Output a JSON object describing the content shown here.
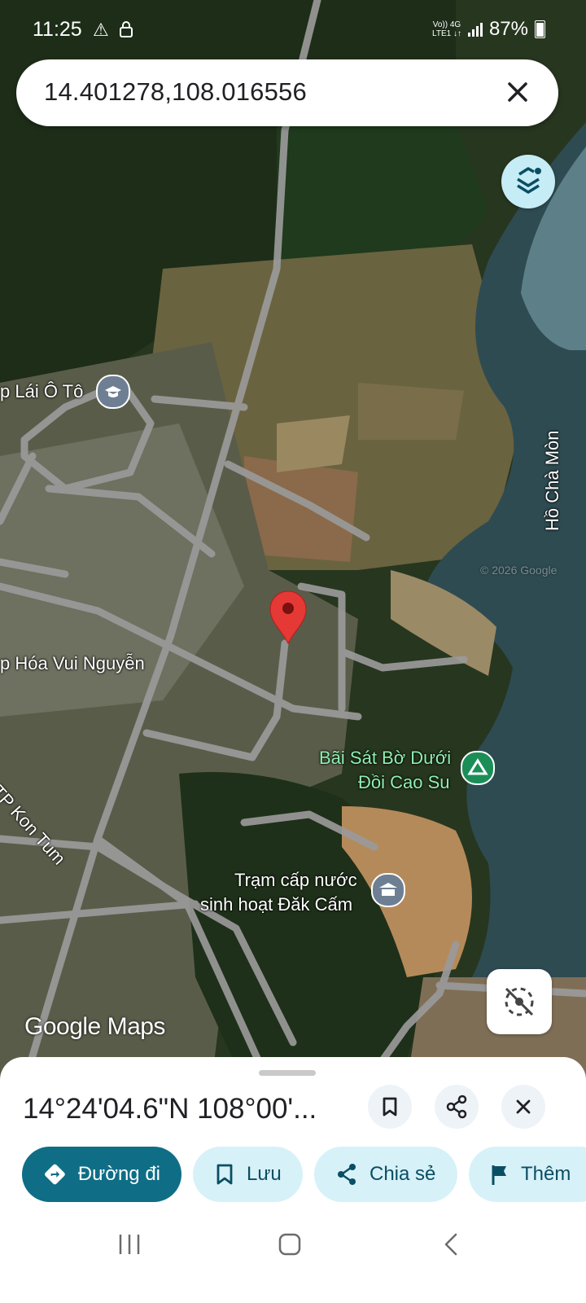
{
  "status_bar": {
    "time": "11:25",
    "network_top": "Vo)) 4G",
    "network_bottom": "LTE1 ↓↑",
    "battery": "87%"
  },
  "search": {
    "query": "14.401278,108.016556"
  },
  "map": {
    "labels": {
      "driving_school": "p Lái Ô Tô",
      "grocery": "p Hóa Vui Nguyễn",
      "road": "h TP Kon Tum",
      "lake": "Hồ Chà Mòn",
      "camp_line1": "Bãi Sát Bờ Dưới",
      "camp_line2": "Đồi Cao Su",
      "water_line1": "Trạm cấp nước",
      "water_line2": "sinh hoạt Đăk Cấm",
      "copyright": "© 2026 Google"
    },
    "watermark": "Google Maps"
  },
  "place_sheet": {
    "coordinates": "14°24'04.6\"N 108°00'...",
    "actions": [
      {
        "label": "Đường đi",
        "icon": "directions-icon"
      },
      {
        "label": "Lưu",
        "icon": "bookmark-icon"
      },
      {
        "label": "Chia sẻ",
        "icon": "share-icon"
      },
      {
        "label": "Thêm",
        "icon": "flag-icon"
      }
    ]
  },
  "colors": {
    "accent": "#0f6e86",
    "chip": "#d7f1f8",
    "pin": "#e53935"
  }
}
